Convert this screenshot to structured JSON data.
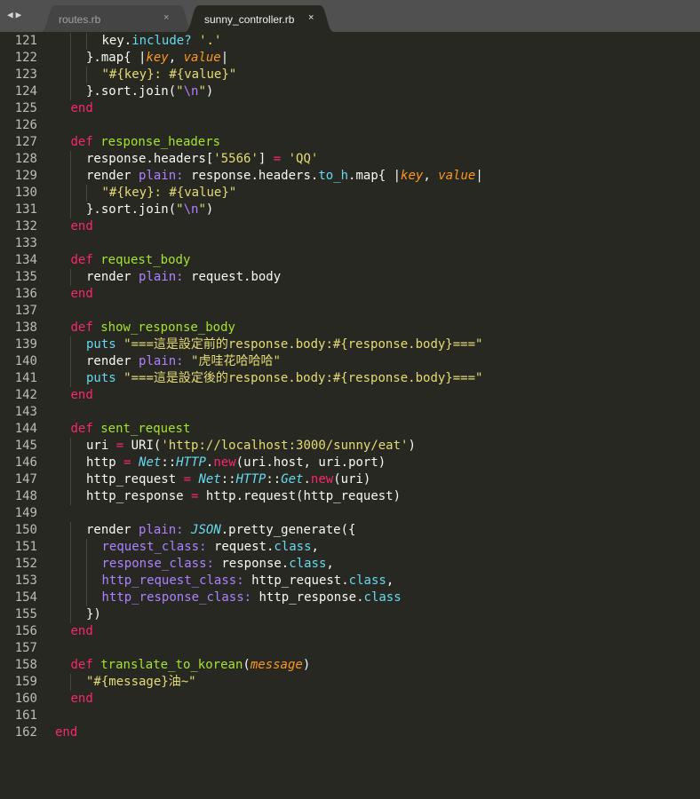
{
  "tabs": [
    {
      "label": "routes.rb",
      "close": "×",
      "active": false
    },
    {
      "label": "sunny_controller.rb",
      "close": "×",
      "active": true
    }
  ],
  "nav": {
    "back_icon": "◀",
    "forward_icon": "▶"
  },
  "colors": {
    "background": "#272822",
    "tabbar": "#505050",
    "active_tab": "#272822",
    "keyword": "#f92672",
    "string": "#e6db74",
    "function": "#a6e22e",
    "argument": "#fd971f",
    "constant": "#66d9ef",
    "symbol": "#ae81ff"
  },
  "lines": [
    {
      "n": "121",
      "indent": 3,
      "toks": [
        [
          "n",
          "key."
        ],
        [
          "m",
          "include?"
        ],
        [
          "n",
          " "
        ],
        [
          "s",
          "'.'"
        ]
      ]
    },
    {
      "n": "122",
      "indent": 2,
      "toks": [
        [
          "n",
          "}.map{ |"
        ],
        [
          "a",
          "key"
        ],
        [
          "n",
          ", "
        ],
        [
          "a",
          "value"
        ],
        [
          "n",
          "|"
        ]
      ]
    },
    {
      "n": "123",
      "indent": 3,
      "toks": [
        [
          "s",
          "\"#{key}: #{value}\""
        ]
      ]
    },
    {
      "n": "124",
      "indent": 2,
      "toks": [
        [
          "n",
          "}.sort.join("
        ],
        [
          "s",
          "\""
        ],
        [
          "sym",
          "\\n"
        ],
        [
          "s",
          "\""
        ],
        [
          "n",
          ")"
        ]
      ]
    },
    {
      "n": "125",
      "indent": 1,
      "toks": [
        [
          "k",
          "end"
        ]
      ]
    },
    {
      "n": "126",
      "indent": 0,
      "toks": []
    },
    {
      "n": "127",
      "indent": 1,
      "toks": [
        [
          "k",
          "def"
        ],
        [
          "n",
          " "
        ],
        [
          "f",
          "response_headers"
        ]
      ]
    },
    {
      "n": "128",
      "indent": 2,
      "toks": [
        [
          "n",
          "response.headers["
        ],
        [
          "s",
          "'5566'"
        ],
        [
          "n",
          "] "
        ],
        [
          "o",
          "="
        ],
        [
          "n",
          " "
        ],
        [
          "s",
          "'QQ'"
        ]
      ]
    },
    {
      "n": "129",
      "indent": 2,
      "toks": [
        [
          "n",
          "render "
        ],
        [
          "sym",
          "plain:"
        ],
        [
          "n",
          " response.headers."
        ],
        [
          "m",
          "to_h"
        ],
        [
          "n",
          ".map{ |"
        ],
        [
          "a",
          "key"
        ],
        [
          "n",
          ", "
        ],
        [
          "a",
          "value"
        ],
        [
          "n",
          "|"
        ]
      ]
    },
    {
      "n": "130",
      "indent": 3,
      "toks": [
        [
          "s",
          "\"#{key}: #{value}\""
        ]
      ]
    },
    {
      "n": "131",
      "indent": 2,
      "toks": [
        [
          "n",
          "}.sort.join("
        ],
        [
          "s",
          "\""
        ],
        [
          "sym",
          "\\n"
        ],
        [
          "s",
          "\""
        ],
        [
          "n",
          ")"
        ]
      ]
    },
    {
      "n": "132",
      "indent": 1,
      "toks": [
        [
          "k",
          "end"
        ]
      ]
    },
    {
      "n": "133",
      "indent": 0,
      "toks": []
    },
    {
      "n": "134",
      "indent": 1,
      "toks": [
        [
          "k",
          "def"
        ],
        [
          "n",
          " "
        ],
        [
          "f",
          "request_body"
        ]
      ]
    },
    {
      "n": "135",
      "indent": 2,
      "toks": [
        [
          "n",
          "render "
        ],
        [
          "sym",
          "plain:"
        ],
        [
          "n",
          " request.body"
        ]
      ]
    },
    {
      "n": "136",
      "indent": 1,
      "toks": [
        [
          "k",
          "end"
        ]
      ]
    },
    {
      "n": "137",
      "indent": 0,
      "toks": []
    },
    {
      "n": "138",
      "indent": 1,
      "toks": [
        [
          "k",
          "def"
        ],
        [
          "n",
          " "
        ],
        [
          "f",
          "show_response_body"
        ]
      ]
    },
    {
      "n": "139",
      "indent": 2,
      "toks": [
        [
          "m",
          "puts"
        ],
        [
          "n",
          " "
        ],
        [
          "s",
          "\"===這是設定前的response.body:#{response.body}===\""
        ]
      ]
    },
    {
      "n": "140",
      "indent": 2,
      "toks": [
        [
          "n",
          "render "
        ],
        [
          "sym",
          "plain:"
        ],
        [
          "n",
          " "
        ],
        [
          "s",
          "\"虎哇花哈哈哈\""
        ]
      ]
    },
    {
      "n": "141",
      "indent": 2,
      "toks": [
        [
          "m",
          "puts"
        ],
        [
          "n",
          " "
        ],
        [
          "s",
          "\"===這是設定後的response.body:#{response.body}===\""
        ]
      ]
    },
    {
      "n": "142",
      "indent": 1,
      "toks": [
        [
          "k",
          "end"
        ]
      ]
    },
    {
      "n": "143",
      "indent": 0,
      "toks": []
    },
    {
      "n": "144",
      "indent": 1,
      "toks": [
        [
          "k",
          "def"
        ],
        [
          "n",
          " "
        ],
        [
          "f",
          "sent_request"
        ]
      ]
    },
    {
      "n": "145",
      "indent": 2,
      "toks": [
        [
          "n",
          "uri "
        ],
        [
          "o",
          "="
        ],
        [
          "n",
          " URI("
        ],
        [
          "s",
          "'http://localhost:3000/sunny/eat'"
        ],
        [
          "n",
          ")"
        ]
      ]
    },
    {
      "n": "146",
      "indent": 2,
      "toks": [
        [
          "n",
          "http "
        ],
        [
          "o",
          "="
        ],
        [
          "n",
          " "
        ],
        [
          "c",
          "Net"
        ],
        [
          "n",
          "::"
        ],
        [
          "c",
          "HTTP"
        ],
        [
          "n",
          "."
        ],
        [
          "k",
          "new"
        ],
        [
          "n",
          "(uri.host, uri.port)"
        ]
      ]
    },
    {
      "n": "147",
      "indent": 2,
      "toks": [
        [
          "n",
          "http_request "
        ],
        [
          "o",
          "="
        ],
        [
          "n",
          " "
        ],
        [
          "c",
          "Net"
        ],
        [
          "n",
          "::"
        ],
        [
          "c",
          "HTTP"
        ],
        [
          "n",
          "::"
        ],
        [
          "c",
          "Get"
        ],
        [
          "n",
          "."
        ],
        [
          "k",
          "new"
        ],
        [
          "n",
          "(uri)"
        ]
      ]
    },
    {
      "n": "148",
      "indent": 2,
      "toks": [
        [
          "n",
          "http_response "
        ],
        [
          "o",
          "="
        ],
        [
          "n",
          " http.request(http_request)"
        ]
      ]
    },
    {
      "n": "149",
      "indent": 0,
      "toks": []
    },
    {
      "n": "150",
      "indent": 2,
      "toks": [
        [
          "n",
          "render "
        ],
        [
          "sym",
          "plain:"
        ],
        [
          "n",
          " "
        ],
        [
          "c",
          "JSON"
        ],
        [
          "n",
          ".pretty_generate({"
        ]
      ]
    },
    {
      "n": "151",
      "indent": 3,
      "toks": [
        [
          "sym",
          "request_class:"
        ],
        [
          "n",
          " request."
        ],
        [
          "m",
          "class"
        ],
        [
          "n",
          ","
        ]
      ]
    },
    {
      "n": "152",
      "indent": 3,
      "toks": [
        [
          "sym",
          "response_class:"
        ],
        [
          "n",
          " response."
        ],
        [
          "m",
          "class"
        ],
        [
          "n",
          ","
        ]
      ]
    },
    {
      "n": "153",
      "indent": 3,
      "toks": [
        [
          "sym",
          "http_request_class:"
        ],
        [
          "n",
          " http_request."
        ],
        [
          "m",
          "class"
        ],
        [
          "n",
          ","
        ]
      ]
    },
    {
      "n": "154",
      "indent": 3,
      "toks": [
        [
          "sym",
          "http_response_class:"
        ],
        [
          "n",
          " http_response."
        ],
        [
          "m",
          "class"
        ]
      ]
    },
    {
      "n": "155",
      "indent": 2,
      "toks": [
        [
          "n",
          "})"
        ]
      ]
    },
    {
      "n": "156",
      "indent": 1,
      "toks": [
        [
          "k",
          "end"
        ]
      ]
    },
    {
      "n": "157",
      "indent": 0,
      "toks": []
    },
    {
      "n": "158",
      "indent": 1,
      "toks": [
        [
          "k",
          "def"
        ],
        [
          "n",
          " "
        ],
        [
          "f",
          "translate_to_korean"
        ],
        [
          "n",
          "("
        ],
        [
          "a",
          "message"
        ],
        [
          "n",
          ")"
        ]
      ]
    },
    {
      "n": "159",
      "indent": 2,
      "toks": [
        [
          "s",
          "\"#{message}油~\""
        ]
      ]
    },
    {
      "n": "160",
      "indent": 1,
      "toks": [
        [
          "k",
          "end"
        ]
      ]
    },
    {
      "n": "161",
      "indent": 0,
      "toks": []
    },
    {
      "n": "162",
      "indent": 0,
      "toks": [
        [
          "k",
          "end"
        ]
      ]
    }
  ]
}
